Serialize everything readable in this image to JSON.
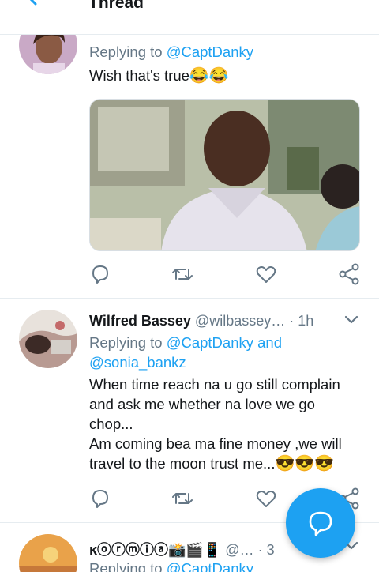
{
  "header": {
    "title": "Thread"
  },
  "tweets": [
    {
      "reply_prefix": "Replying to",
      "reply_mentions": "@CaptDanky",
      "text": "Wish that's true",
      "text_emoji": "😂😂"
    },
    {
      "display_name": "Wilfred Bassey",
      "handle": "@wilbassey…",
      "dot": "·",
      "time": "1h",
      "reply_prefix": "Replying to",
      "reply_mention_1": "@CaptDanky and",
      "reply_mention_2": "@sonia_bankz",
      "text_1": "When time reach na u go still complain and ask me whether na love we go chop...",
      "text_2": "Am coming bea ma fine money ,we will travel to the moon trust me...",
      "text_emoji": "😎😎😎"
    },
    {
      "display_name": "ĸⓞⓡⓜⓘⓐ📸🎬📱",
      "handle": "@…",
      "dot": "·",
      "time": "3",
      "reply_prefix": "Replying to",
      "reply_mentions": "@CaptDanky"
    }
  ],
  "colors": {
    "accent": "#1da1f2",
    "secondary_text": "#657786",
    "primary_text": "#14171a",
    "divider": "#e6ecf0"
  },
  "icons": [
    "back-arrow-icon",
    "reply-icon",
    "retweet-icon",
    "like-icon",
    "share-icon",
    "chevron-down-icon",
    "compose-reply-icon"
  ]
}
